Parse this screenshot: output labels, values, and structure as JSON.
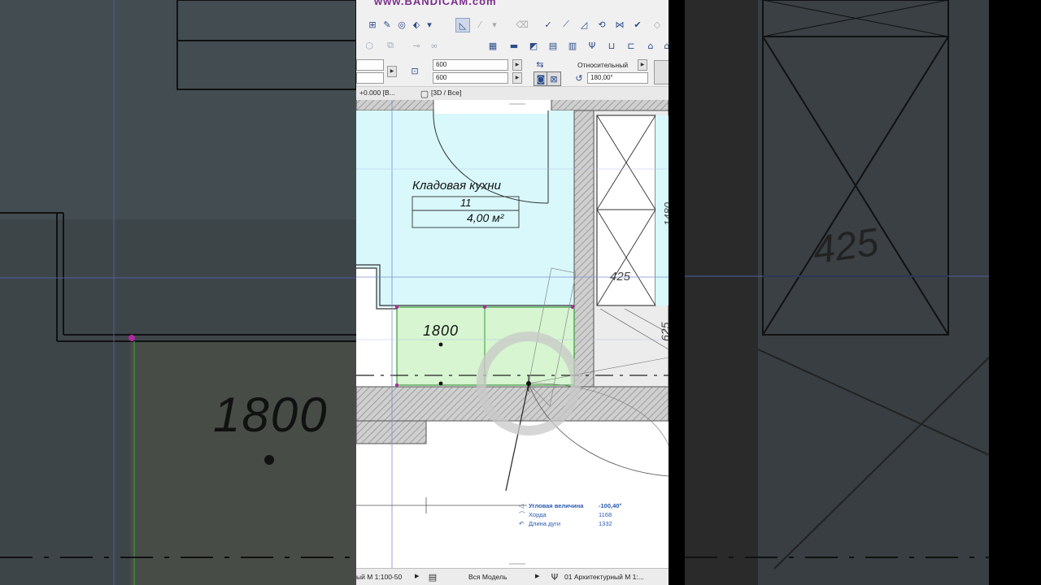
{
  "watermark": "www.BANDICAM.com",
  "toolbar": {
    "width_value": "600",
    "height_value": "600",
    "mode_label": "Относительный",
    "angle_value": "180,00°"
  },
  "infobar": {
    "elevation_text": "+0.000 [В...",
    "view_text": "[3D / Все]"
  },
  "plan": {
    "room_name": "Кладовая кухни",
    "room_number": "11",
    "room_area": "4,00 м²",
    "dim_1800": "1800",
    "dim_425": "425",
    "dim_625": "625",
    "dim_1480": "1480"
  },
  "tracker": {
    "angle_label": "Угловая величина",
    "angle_value": "-100,40°",
    "chord_label": "Хорда",
    "chord_value": "1168",
    "arc_label": "Длина дуги",
    "arc_value": "1332"
  },
  "statusbar": {
    "scale_text": "ый М 1:100-50",
    "model_text": "Вся Модель",
    "layer_text": "01 Архитектурный М 1:..."
  },
  "colors": {
    "room_fill": "#d8f8fb",
    "zone_fill": "#d6f5d0",
    "wall_hatch": "#b0b0b0",
    "accent": "#2a5ab0",
    "toolbar_bg": "#f0f0f0"
  }
}
